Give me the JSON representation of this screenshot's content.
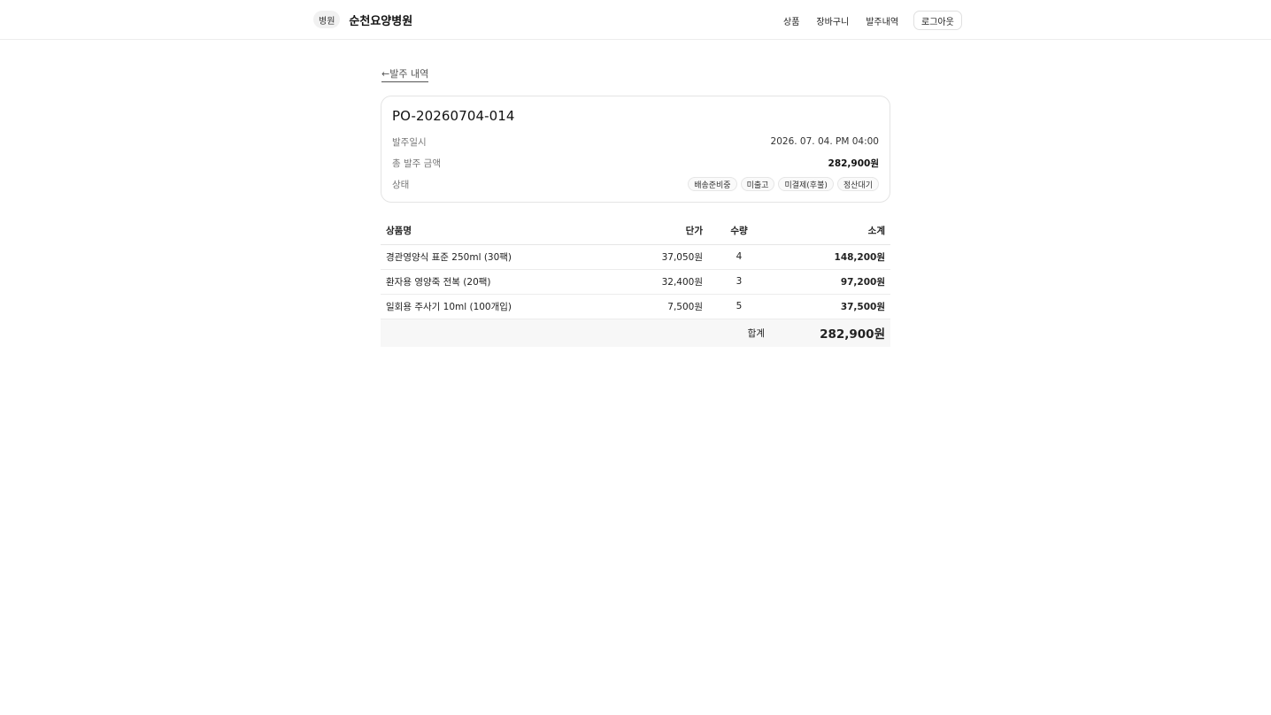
{
  "header": {
    "badge": "병원",
    "hospital_name": "순천요양병원",
    "nav": [
      "상품",
      "장바구니",
      "발주내역"
    ],
    "logout": "로그아웃"
  },
  "back_link": "←발주 내역",
  "order": {
    "number": "PO-20260704-014",
    "date_label": "발주일시",
    "date_value": "2026. 07. 04. PM 04:00",
    "amount_label": "총 발주 금액",
    "amount_value": "282,900원",
    "status_label": "상태",
    "statuses": [
      "배송준비중",
      "미출고",
      "미결제(후불)",
      "정산대기"
    ]
  },
  "table": {
    "headers": {
      "name": "상품명",
      "price": "단가",
      "qty": "수량",
      "subtotal": "소계"
    },
    "rows": [
      {
        "name": "경관영양식 표준 250ml (30팩)",
        "price": "37,050원",
        "qty": "4",
        "subtotal": "148,200원"
      },
      {
        "name": "환자용 영양죽 전복 (20팩)",
        "price": "32,400원",
        "qty": "3",
        "subtotal": "97,200원"
      },
      {
        "name": "일회용 주사기 10ml (100개입)",
        "price": "7,500원",
        "qty": "5",
        "subtotal": "37,500원"
      }
    ],
    "total_label": "합계",
    "total_value": "282,900원"
  }
}
